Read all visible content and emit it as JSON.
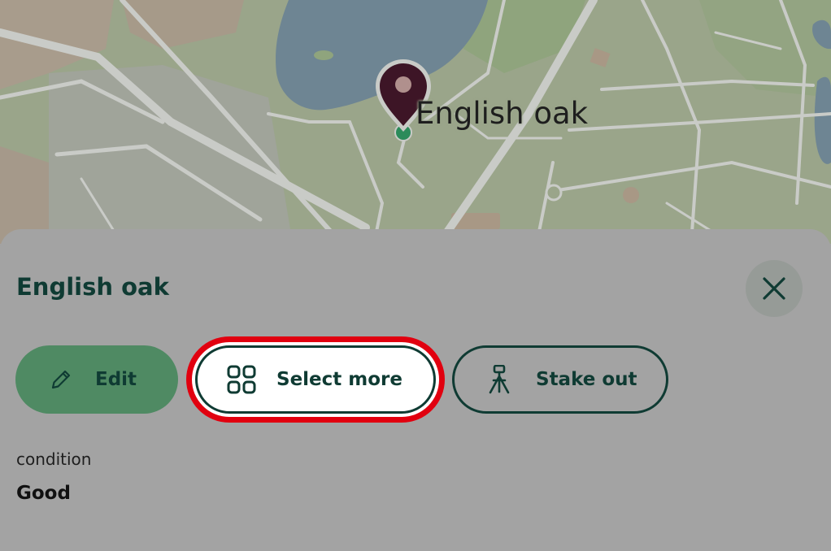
{
  "map": {
    "feature_label": "English oak",
    "pin_icon": "map-pin-icon"
  },
  "sheet": {
    "title": "English oak",
    "close_icon": "close-icon",
    "actions": {
      "edit": {
        "label": "Edit",
        "icon": "pencil-icon"
      },
      "select_more": {
        "label": "Select more",
        "icon": "grid-icon"
      },
      "stake_out": {
        "label": "Stake out",
        "icon": "survey-tripod-icon"
      }
    },
    "fields": [
      {
        "label": "condition",
        "value": "Good"
      }
    ]
  },
  "colors": {
    "primary_dark": "#0f3b33",
    "edit_green": "#4f8a63",
    "highlight_red": "#e1000f",
    "pin_color": "#3d1526",
    "sheet_bg": "#a3a3a3"
  }
}
